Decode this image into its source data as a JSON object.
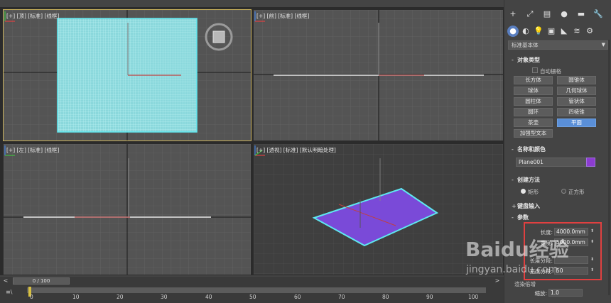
{
  "viewports": {
    "top": {
      "label": "[+] [顶] [标准] [线框]"
    },
    "front": {
      "label": "[+] [前] [标准] [线框]"
    },
    "left": {
      "label": "[+] [左] [标准] [线框]"
    },
    "persp": {
      "label": "[+] [透视] [标准] [默认明暗处理]"
    }
  },
  "timeline": {
    "frame_display": "0 / 100",
    "ticks": [
      "0",
      "10",
      "20",
      "30",
      "40",
      "50",
      "60",
      "70",
      "80",
      "90",
      "100"
    ],
    "prev_arrow": "<",
    "next_arrow": ">",
    "icon": "≡\\"
  },
  "command_panel": {
    "tabs_row1": [
      "+",
      "⤢",
      "▤",
      "●",
      "▬",
      "🔧"
    ],
    "tabs_row2": [
      "●",
      "◐",
      "💡",
      "▣",
      "◣",
      "≋",
      "⚙"
    ],
    "dropdown_value": "标准基本体",
    "rollouts": {
      "object_type": {
        "title": "对象类型",
        "autogrid_label": "自动栅格",
        "buttons": [
          "长方体",
          "圆锥体",
          "球体",
          "几何球体",
          "圆柱体",
          "管状体",
          "圆环",
          "四棱锥",
          "茶壶",
          "平面",
          "加强型文本"
        ],
        "selected": "平面"
      },
      "name_color": {
        "title": "名称和颜色",
        "name_value": "Plane001",
        "color": "#8c3cd0"
      },
      "creation_method": {
        "title": "创建方法",
        "options": [
          "矩形",
          "正方形"
        ],
        "selected": "矩形"
      },
      "keyboard_entry": {
        "title": "键盘输入"
      },
      "parameters": {
        "title": "参数",
        "length_label": "长度:",
        "length_value": "4000.0mm",
        "width_label": "宽度:",
        "width_value": "5000.0mm",
        "length_segs_label": "长度分段:",
        "width_segs_label": "宽度分段:",
        "width_segs_value": "50",
        "render_mult_label": "渲染倍增",
        "scale_label": "缩放:",
        "scale_value": "1.0"
      }
    }
  },
  "watermark": {
    "brand": "Baidu经验",
    "url": "jingyan.baidu.com"
  },
  "colors": {
    "plane_wire": "#a8f0f0",
    "plane_fill": "#7a4ad8",
    "selection_outline": "#5ee8f0",
    "accent_blue": "#5a8fd8",
    "highlight_red": "#e04040"
  }
}
